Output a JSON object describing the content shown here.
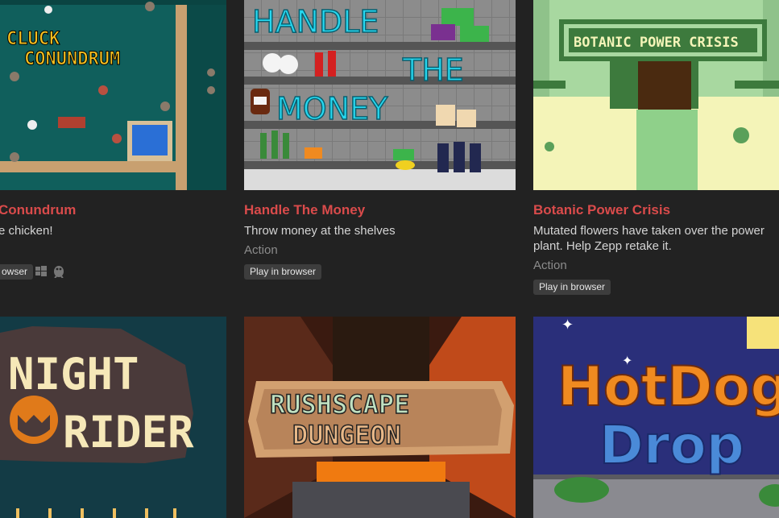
{
  "games": [
    {
      "title": "Cluck Conundrum",
      "title_visible": "Conundrum",
      "cover_text_line1": "CLUCK",
      "cover_text_line2": "CONUNDRUM",
      "description_visible": "e chicken!",
      "tag_visible": "owser",
      "platforms": [
        "windows-icon",
        "linux-icon"
      ]
    },
    {
      "title": "Handle The Money",
      "cover_words": [
        "HANDLE",
        "THE",
        "MONEY"
      ],
      "description": "Throw money at the shelves",
      "genre": "Action",
      "tag": "Play in browser"
    },
    {
      "title": "Botanic Power Crisis",
      "cover_text": "BOTANIC POWER CRISIS",
      "description_line1": "Mutated flowers have taken over the power",
      "description_line2": "plant. Help Zepp retake it.",
      "genre": "Action",
      "tag": "Play in browser"
    },
    {
      "cover_text_line1": "NIGHT",
      "cover_text_line2": "RIDER"
    },
    {
      "cover_text_line1": "RUSHSCAPE",
      "cover_text_line2": "DUNGEON"
    },
    {
      "cover_text_line1": "HotDog",
      "cover_text_line2": "Drop"
    }
  ],
  "colors": {
    "background": "#222222",
    "title": "#da4b4b",
    "description": "#d4d4d4",
    "genre": "#8c8c8c",
    "tag_bg": "#3d3d3d"
  }
}
